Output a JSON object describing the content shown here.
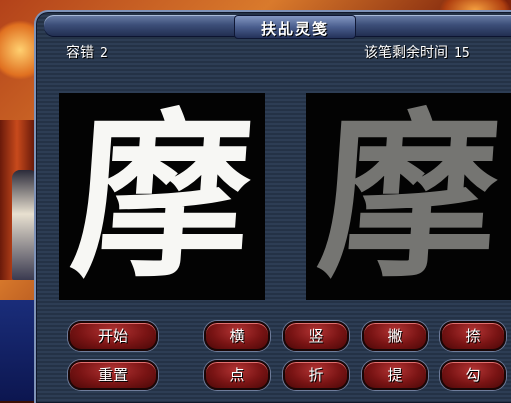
{
  "window": {
    "title": "扶乩灵笺"
  },
  "stats": {
    "tolerance_label": "容错",
    "tolerance_value": "2",
    "time_label": "该笔剩余时间",
    "time_value": "15"
  },
  "characters": {
    "target": "摩",
    "traced": "摩"
  },
  "buttons": {
    "start": "开始",
    "reset": "重置",
    "strokes": [
      {
        "label": "横"
      },
      {
        "label": "竖"
      },
      {
        "label": "撇"
      },
      {
        "label": "捺"
      },
      {
        "label": "点"
      },
      {
        "label": "折"
      },
      {
        "label": "提"
      },
      {
        "label": "勾"
      }
    ]
  },
  "colors": {
    "panel_bg": "#243246",
    "button_red": "#7a1414",
    "target_char": "#f7f7f4",
    "traced_char": "#8a8a86"
  }
}
